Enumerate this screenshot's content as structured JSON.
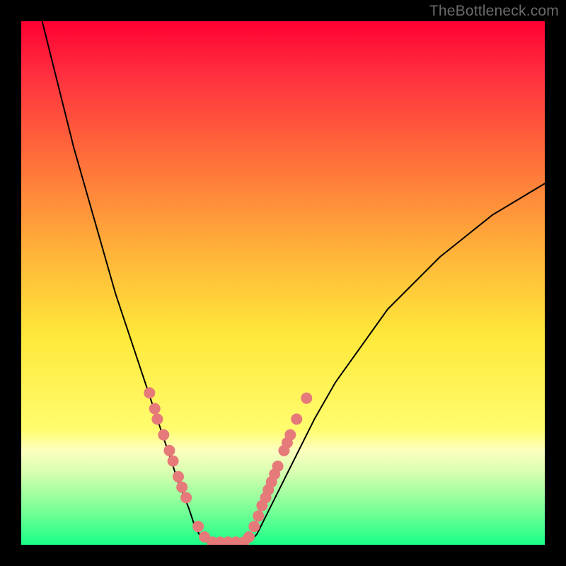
{
  "watermark": "TheBottleneck.com",
  "chart_data": {
    "type": "line",
    "title": "",
    "xlabel": "",
    "ylabel": "",
    "xlim": [
      0,
      100
    ],
    "ylim": [
      0,
      100
    ],
    "grid": false,
    "legend": false,
    "background": {
      "type": "vertical-gradient",
      "stops": [
        {
          "pos": 0.0,
          "color": "#ff0032"
        },
        {
          "pos": 0.1,
          "color": "#ff2f3f"
        },
        {
          "pos": 0.25,
          "color": "#ff6a3a"
        },
        {
          "pos": 0.45,
          "color": "#ffb63a"
        },
        {
          "pos": 0.6,
          "color": "#ffe83a"
        },
        {
          "pos": 0.78,
          "color": "#fffd6f"
        },
        {
          "pos": 0.82,
          "color": "#fdffc0"
        },
        {
          "pos": 0.86,
          "color": "#d9ffb0"
        },
        {
          "pos": 0.92,
          "color": "#8cff9a"
        },
        {
          "pos": 1.0,
          "color": "#1aff86"
        }
      ]
    },
    "series": [
      {
        "name": "left-branch",
        "color": "#000000",
        "width": 2,
        "x": [
          4,
          6,
          8,
          10,
          12,
          14,
          16,
          18,
          20,
          22,
          24,
          26,
          28,
          30,
          32,
          33,
          34,
          35,
          36
        ],
        "y": [
          100,
          92,
          84,
          76,
          69,
          62,
          55,
          48,
          42,
          36,
          30,
          24,
          18,
          12,
          7,
          4,
          2,
          1,
          0
        ]
      },
      {
        "name": "valley-floor",
        "color": "#000000",
        "width": 2,
        "x": [
          36,
          37,
          38,
          39,
          40,
          41,
          42,
          43
        ],
        "y": [
          0,
          0,
          0,
          0,
          0,
          0,
          0,
          0
        ]
      },
      {
        "name": "right-branch",
        "color": "#000000",
        "width": 2,
        "x": [
          43,
          44,
          45,
          46,
          48,
          50,
          53,
          56,
          60,
          65,
          70,
          75,
          80,
          85,
          90,
          95,
          100
        ],
        "y": [
          0,
          1,
          2,
          4,
          8,
          12,
          18,
          24,
          31,
          38,
          45,
          50,
          55,
          59,
          63,
          66,
          69
        ]
      }
    ],
    "markers": [
      {
        "name": "dots",
        "color": "#e67a7a",
        "radius": 8,
        "points": [
          {
            "x": 24.5,
            "y": 29
          },
          {
            "x": 25.5,
            "y": 26
          },
          {
            "x": 26.0,
            "y": 24
          },
          {
            "x": 27.2,
            "y": 21
          },
          {
            "x": 28.3,
            "y": 18
          },
          {
            "x": 29.0,
            "y": 16
          },
          {
            "x": 30.0,
            "y": 13
          },
          {
            "x": 30.7,
            "y": 11
          },
          {
            "x": 31.5,
            "y": 9
          },
          {
            "x": 33.8,
            "y": 3.5
          },
          {
            "x": 35.0,
            "y": 1.5
          },
          {
            "x": 36.5,
            "y": 0.5
          },
          {
            "x": 38.0,
            "y": 0.5
          },
          {
            "x": 39.5,
            "y": 0.5
          },
          {
            "x": 41.0,
            "y": 0.5
          },
          {
            "x": 42.5,
            "y": 0.5
          },
          {
            "x": 43.5,
            "y": 1.5
          },
          {
            "x": 44.5,
            "y": 3.5
          },
          {
            "x": 45.3,
            "y": 5.5
          },
          {
            "x": 46.0,
            "y": 7.5
          },
          {
            "x": 46.7,
            "y": 9
          },
          {
            "x": 47.2,
            "y": 10.5
          },
          {
            "x": 47.8,
            "y": 12
          },
          {
            "x": 48.4,
            "y": 13.5
          },
          {
            "x": 49.0,
            "y": 15
          },
          {
            "x": 50.2,
            "y": 18
          },
          {
            "x": 50.8,
            "y": 19.5
          },
          {
            "x": 51.4,
            "y": 21
          },
          {
            "x": 52.6,
            "y": 24
          },
          {
            "x": 54.5,
            "y": 28
          }
        ]
      }
    ]
  }
}
